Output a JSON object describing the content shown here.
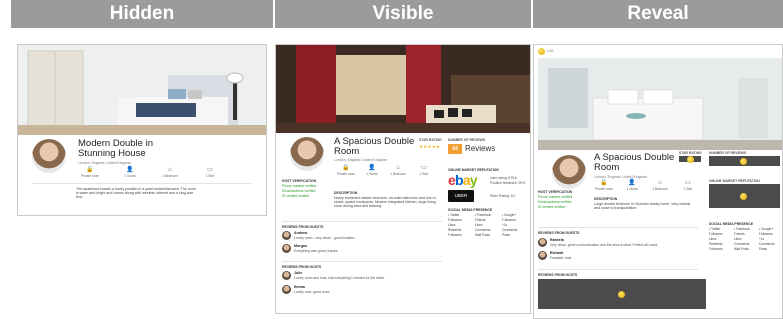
{
  "columns": [
    {
      "key": "hidden",
      "header": "Hidden"
    },
    {
      "key": "visible",
      "header": "Visible"
    },
    {
      "key": "reveal",
      "header": "Reveal"
    }
  ],
  "hidden": {
    "title_line1": "Modern Double in",
    "title_line2": "Stunning House",
    "location": "London, England, United Kingdom",
    "features": [
      "Private room",
      "1 Guest",
      "1 Bedroom",
      "1 Bed"
    ],
    "description": "The apartment boasts a lovely position in a quiet residential area. The room is warm and bright and comes along with wireless internet and a king-size bed."
  },
  "visible": {
    "title_line1": "A Spacious Double",
    "title_line2": "Room",
    "location": "London, England, United Kingdom",
    "star_rating_label": "STAR RATING",
    "num_reviews_label": "NUMBER OF REVIEWS",
    "reviews_count": "64",
    "reviews_word": "Reviews",
    "features": [
      "Private room",
      "1 Guest",
      "1 Bedroom",
      "1 Bed"
    ],
    "host_verification_label": "HOST VERIFICATION",
    "verifications": [
      "Phone number verified",
      "Email address verified",
      "ID verified verified"
    ],
    "description_label": "DESCRIPTION",
    "description": "Newly furnished master bedroom, en-suite bathroom and one in-closet, quaint courtyards. Modern integrated kitchen, large living room dining area and balcony.",
    "online_market_label": "ONLINE MARKET REPUTATION",
    "ebay_text": "ebay",
    "ebay_stat1": "User rating: 675★",
    "ebay_stat2": "Positive feedback: 99%",
    "uber_text": "UBER",
    "uber_stat": "Rider Rating: 5.0",
    "social_label": "SOCIAL MEDIA PRESENCE",
    "social_headers": [
      "Twitter",
      "Facebook",
      "Google+"
    ],
    "social_rows": [
      [
        "Followers",
        "Friends",
        "Followers"
      ],
      [
        "Likes",
        "Likes",
        "+1s"
      ],
      [
        "Retweets",
        "Comments",
        "Comments"
      ],
      [
        "Followers",
        "Wall Posts",
        "Posts"
      ]
    ],
    "reviews_guests_label": "REVIEWS FROM GUESTS",
    "guest_reviews": [
      {
        "name": "Andrew",
        "text": "Lovely room - very clean - good location..."
      },
      {
        "name": "Morgan",
        "text": "Everything was great, thanks"
      }
    ],
    "reviews_hosts_label": "REVIEWS FROM HOSTS",
    "host_reviews": [
      {
        "name": "Julie",
        "text": "Lovely room and host, had everything I needed for the week."
      },
      {
        "name": "Emma",
        "text": "Lovely host, great room"
      }
    ]
  },
  "reveal": {
    "coins_text": "x 10",
    "title_line1": "A Spacious Double",
    "title_line2": "Room",
    "location": "London, England, United Kingdom",
    "star_rating_label": "STAR RATING",
    "num_reviews_label": "NUMBER OF REVIEWS",
    "online_market_label": "ONLINE MARKET REPUTATION",
    "features": [
      "Private room",
      "1 Guest",
      "1 Bedroom",
      "1 Bed"
    ],
    "host_verification_label": "HOST VERIFICATION",
    "verifications": [
      "Phone number verified",
      "Email address verified",
      "ID verified verified"
    ],
    "description_label": "DESCRIPTION",
    "description": "Large double bedroom in Victorian family home. Very central and close to transportation.",
    "social_label": "SOCIAL MEDIA PRESENCE",
    "social_headers": [
      "Twitter",
      "Facebook",
      "Google+"
    ],
    "social_rows": [
      [
        "Followers",
        "Friends",
        "Followers"
      ],
      [
        "Likes",
        "Likes",
        "+1s"
      ],
      [
        "Retweets",
        "Comments",
        "Comments"
      ],
      [
        "Followers",
        "Wall Posts",
        "Posts"
      ]
    ],
    "reviews_guests_label": "REVIEWS FROM GUESTS",
    "guest_reviews": [
      {
        "name": "Raheela",
        "text": "Very clean, great communication and the area is ideal. Perfect all round."
      },
      {
        "name": "Richard",
        "text": "Fantastic host."
      }
    ],
    "reviews_hosts_label": "REVIEWS FROM HOSTS"
  }
}
